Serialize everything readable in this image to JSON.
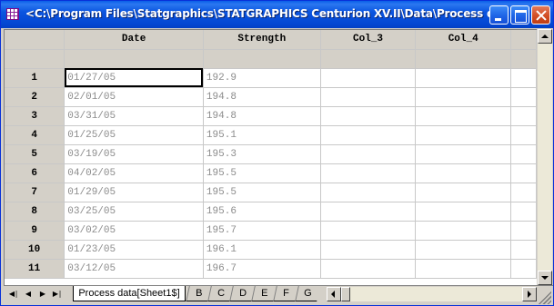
{
  "window": {
    "title": "<C:\\Program Files\\Statgraphics\\STATGRAPHICS Centurion XV.II\\Data\\Process da..."
  },
  "grid": {
    "columns": [
      "Date",
      "Strength",
      "Col_3",
      "Col_4"
    ],
    "rows": [
      {
        "num": "1",
        "date": "01/27/05",
        "strength": "192.9"
      },
      {
        "num": "2",
        "date": "02/01/05",
        "strength": "194.8"
      },
      {
        "num": "3",
        "date": "03/31/05",
        "strength": "194.8"
      },
      {
        "num": "4",
        "date": "01/25/05",
        "strength": "195.1"
      },
      {
        "num": "5",
        "date": "03/19/05",
        "strength": "195.3"
      },
      {
        "num": "6",
        "date": "04/02/05",
        "strength": "195.5"
      },
      {
        "num": "7",
        "date": "01/29/05",
        "strength": "195.5"
      },
      {
        "num": "8",
        "date": "03/25/05",
        "strength": "195.6"
      },
      {
        "num": "9",
        "date": "03/02/05",
        "strength": "195.7"
      },
      {
        "num": "10",
        "date": "01/23/05",
        "strength": "196.1"
      },
      {
        "num": "11",
        "date": "03/12/05",
        "strength": "196.7"
      }
    ]
  },
  "sheets": {
    "active": "Process data[Sheet1$]",
    "others": [
      "B",
      "C",
      "D",
      "E",
      "F",
      "G"
    ]
  },
  "nav_icons": [
    "first-icon",
    "prev-icon",
    "next-icon",
    "last-icon"
  ]
}
